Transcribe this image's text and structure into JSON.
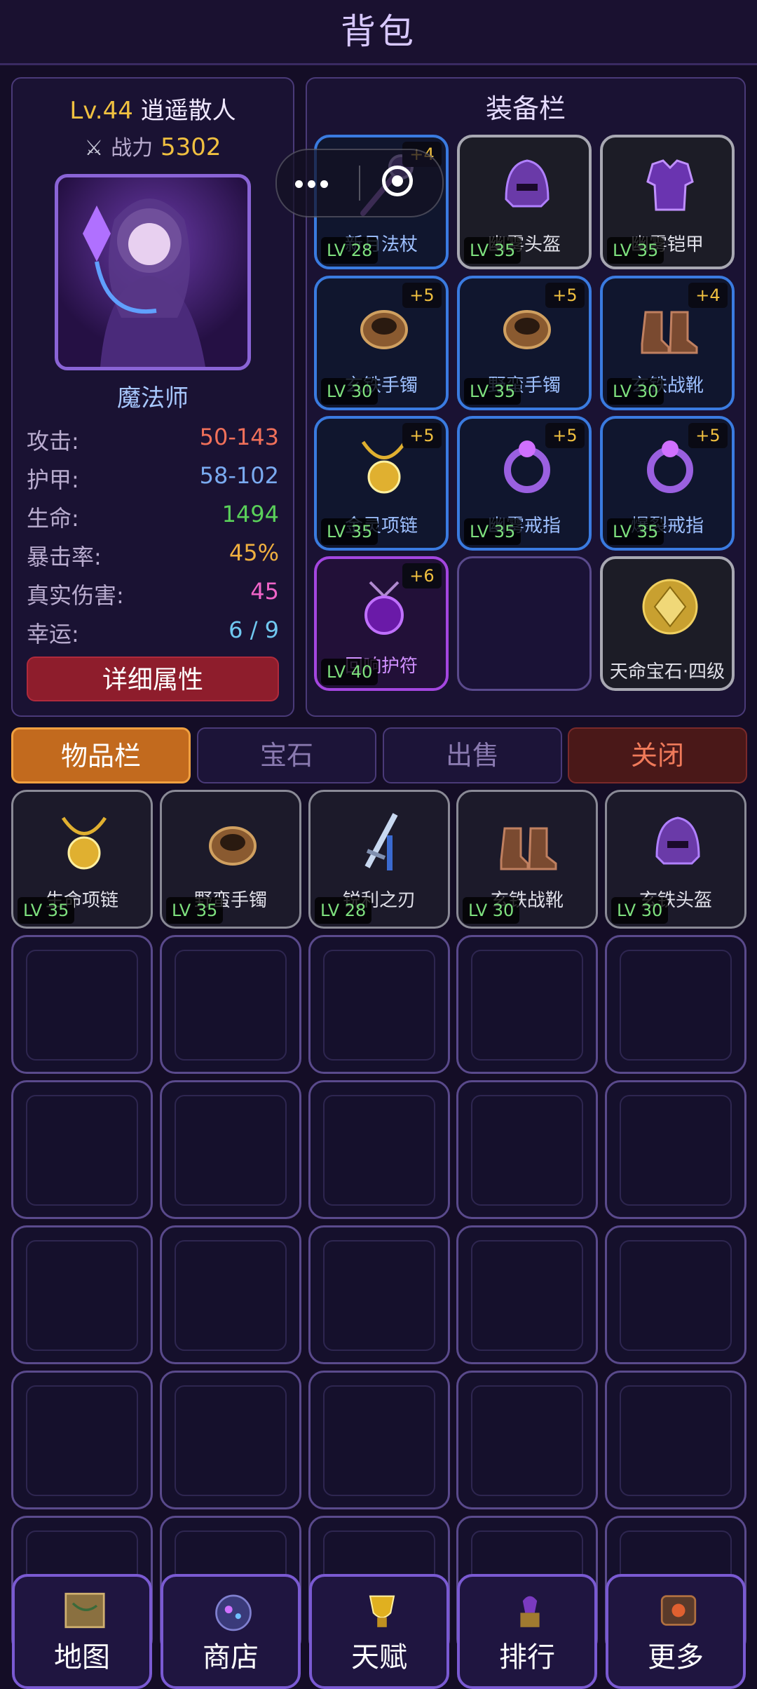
{
  "title": "背包",
  "hero": {
    "level": "Lv.44",
    "name": "逍遥散人",
    "power_label": "战力",
    "power": "5302",
    "class": "魔法师",
    "detail_button": "详细属性",
    "stats": [
      {
        "label": "攻击:",
        "value": "50-143",
        "color": "#f0705a"
      },
      {
        "label": "护甲:",
        "value": "58-102",
        "color": "#7aaaf0"
      },
      {
        "label": "生命:",
        "value": "1494",
        "color": "#5ad05a"
      },
      {
        "label": "暴击率:",
        "value": "45%",
        "color": "#f0b040"
      },
      {
        "label": "真实伤害:",
        "value": "45",
        "color": "#f064c8"
      },
      {
        "label": "幸运:",
        "value": "6 / 9",
        "color": "#70c8f0"
      }
    ]
  },
  "equipment": {
    "title": "装备栏",
    "slots": [
      {
        "name": "新月法杖",
        "plus": "+4",
        "level": "LV 28",
        "rarity": "blue",
        "icon": "staff-icon"
      },
      {
        "name": "幽雾头盔",
        "plus": "",
        "level": "LV 35",
        "rarity": "gray",
        "icon": "helmet-icon"
      },
      {
        "name": "幽雾铠甲",
        "plus": "",
        "level": "LV 35",
        "rarity": "gray",
        "icon": "armor-icon"
      },
      {
        "name": "玄铁手镯",
        "plus": "+5",
        "level": "LV 30",
        "rarity": "blue",
        "icon": "bracelet-icon"
      },
      {
        "name": "野蛮手镯",
        "plus": "+5",
        "level": "LV 35",
        "rarity": "blue",
        "icon": "bracelet-icon"
      },
      {
        "name": "玄铁战靴",
        "plus": "+4",
        "level": "LV 30",
        "rarity": "blue",
        "icon": "boots-icon"
      },
      {
        "name": "金灵项链",
        "plus": "+5",
        "level": "LV 35",
        "rarity": "blue",
        "icon": "necklace-icon"
      },
      {
        "name": "幽雾戒指",
        "plus": "+5",
        "level": "LV 35",
        "rarity": "blue",
        "icon": "ring-icon"
      },
      {
        "name": "爆裂戒指",
        "plus": "+5",
        "level": "LV 35",
        "rarity": "blue",
        "icon": "ring-icon"
      },
      {
        "name": "回响护符",
        "plus": "+6",
        "level": "LV 40",
        "rarity": "purple",
        "icon": "amulet-icon"
      },
      {
        "name": "",
        "plus": "",
        "level": "",
        "rarity": "empty",
        "icon": ""
      },
      {
        "name": "天命宝石·四级",
        "plus": "",
        "level": "",
        "rarity": "gray",
        "icon": "gem-icon"
      }
    ]
  },
  "tabs": [
    "物品栏",
    "宝石",
    "出售",
    "关闭"
  ],
  "inventory": [
    {
      "name": "生命项链",
      "level": "LV 35",
      "icon": "necklace-icon"
    },
    {
      "name": "野蛮手镯",
      "level": "LV 35",
      "icon": "bracelet-icon"
    },
    {
      "name": "锐利之刃",
      "level": "LV 28",
      "icon": "sword-icon"
    },
    {
      "name": "玄铁战靴",
      "level": "LV 30",
      "icon": "boots-icon"
    },
    {
      "name": "玄铁头盔",
      "level": "LV 30",
      "icon": "helmet-icon"
    }
  ],
  "nav": [
    {
      "label": "地图",
      "icon": "map-icon"
    },
    {
      "label": "商店",
      "icon": "shop-icon"
    },
    {
      "label": "天赋",
      "icon": "talent-icon"
    },
    {
      "label": "排行",
      "icon": "ranking-icon"
    },
    {
      "label": "更多",
      "icon": "more-icon"
    }
  ]
}
